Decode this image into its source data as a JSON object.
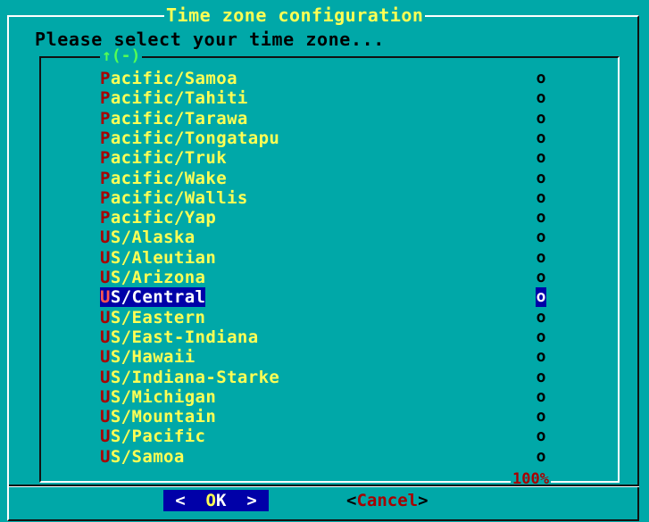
{
  "dialog": {
    "title": "Time zone configuration",
    "prompt": "Please select your time zone...",
    "scroll_up_indicator": "↑(-)",
    "scroll_percent": "100%",
    "ok_label_left": "<  ",
    "ok_hotkey": "O",
    "ok_label_rest": "K  >",
    "cancel_open": "<",
    "cancel_label": "Cancel",
    "cancel_close": ">"
  },
  "timezones": [
    {
      "first": "P",
      "rest": "acific/Samoa",
      "radio": "o",
      "selected": false
    },
    {
      "first": "P",
      "rest": "acific/Tahiti",
      "radio": "o",
      "selected": false
    },
    {
      "first": "P",
      "rest": "acific/Tarawa",
      "radio": "o",
      "selected": false
    },
    {
      "first": "P",
      "rest": "acific/Tongatapu",
      "radio": "o",
      "selected": false
    },
    {
      "first": "P",
      "rest": "acific/Truk",
      "radio": "o",
      "selected": false
    },
    {
      "first": "P",
      "rest": "acific/Wake",
      "radio": "o",
      "selected": false
    },
    {
      "first": "P",
      "rest": "acific/Wallis",
      "radio": "o",
      "selected": false
    },
    {
      "first": "P",
      "rest": "acific/Yap",
      "radio": "o",
      "selected": false
    },
    {
      "first": "U",
      "rest": "S/Alaska",
      "radio": "o",
      "selected": false
    },
    {
      "first": "U",
      "rest": "S/Aleutian",
      "radio": "o",
      "selected": false
    },
    {
      "first": "U",
      "rest": "S/Arizona",
      "radio": "o",
      "selected": false
    },
    {
      "first": "U",
      "rest": "S/Central",
      "radio": "o",
      "selected": true
    },
    {
      "first": "U",
      "rest": "S/Eastern",
      "radio": "o",
      "selected": false
    },
    {
      "first": "U",
      "rest": "S/East-Indiana",
      "radio": "o",
      "selected": false
    },
    {
      "first": "U",
      "rest": "S/Hawaii",
      "radio": "o",
      "selected": false
    },
    {
      "first": "U",
      "rest": "S/Indiana-Starke",
      "radio": "o",
      "selected": false
    },
    {
      "first": "U",
      "rest": "S/Michigan",
      "radio": "o",
      "selected": false
    },
    {
      "first": "U",
      "rest": "S/Mountain",
      "radio": "o",
      "selected": false
    },
    {
      "first": "U",
      "rest": "S/Pacific",
      "radio": "o",
      "selected": false
    },
    {
      "first": "U",
      "rest": "S/Samoa",
      "radio": "o",
      "selected": false
    }
  ]
}
